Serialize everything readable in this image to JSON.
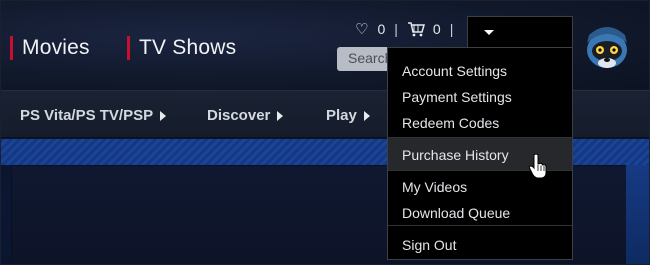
{
  "header": {
    "nav": [
      {
        "label": "Movies"
      },
      {
        "label": "TV Shows"
      }
    ],
    "wishlist": {
      "icon": "heart-icon",
      "count": "0"
    },
    "cart": {
      "icon": "cart-icon",
      "count": "0"
    },
    "separator": "|",
    "search": {
      "placeholder": "Search"
    },
    "account_menu": {
      "icon": "caret-down-icon"
    },
    "avatar": {
      "icon": "avatar-icon"
    }
  },
  "subnav": {
    "items": [
      {
        "label": "PS Vita/PS TV/PSP"
      },
      {
        "label": "Discover"
      },
      {
        "label": "Play"
      }
    ]
  },
  "dropdown": {
    "groups": [
      [
        "Account Settings",
        "Payment Settings",
        "Redeem Codes"
      ],
      [
        "Purchase History"
      ],
      [
        "My Videos",
        "Download Queue"
      ],
      [
        "Sign Out"
      ]
    ],
    "highlighted": "Purchase History"
  },
  "colors": {
    "accent": "#c8102e",
    "dropdown_bg": "#000000",
    "highlight_bg": "#26282c"
  }
}
